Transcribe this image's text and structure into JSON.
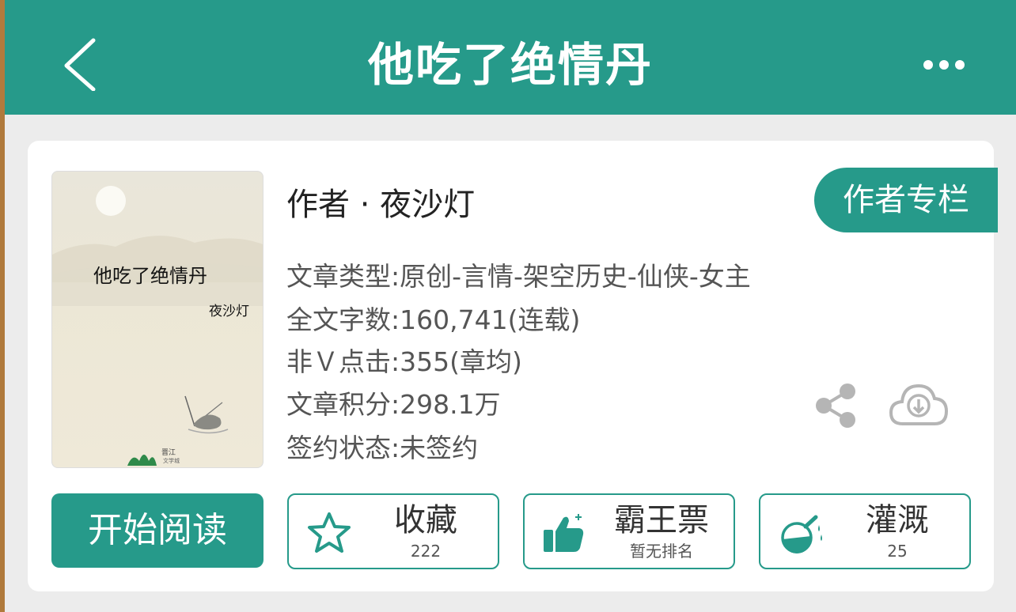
{
  "header": {
    "title": "他吃了绝情丹"
  },
  "cover": {
    "title": "他吃了绝情丹",
    "author": "夜沙灯"
  },
  "book": {
    "author_line": "作者 · 夜沙灯",
    "author_column_label": "作者专栏",
    "meta": [
      "文章类型:原创-言情-架空历史-仙侠-女主",
      "全文字数:160,741(连载)",
      "非Ｖ点击:355(章均)",
      "文章积分:298.1万",
      "签约状态:未签约"
    ]
  },
  "actions": {
    "read_label": "开始阅读",
    "favorite": {
      "label": "收藏",
      "count": "222"
    },
    "vote": {
      "label": "霸王票",
      "sub": "暂无排名"
    },
    "water": {
      "label": "灌溉",
      "count": "25"
    }
  },
  "icons": [
    "back-icon",
    "more-icon",
    "share-icon",
    "download-cloud-icon",
    "star-icon",
    "thumbs-up-icon",
    "flask-icon"
  ],
  "colors": {
    "accent": "#269a8a",
    "header_bg": "#269a8a",
    "page_bg": "#ececec",
    "text_gray": "#555555"
  }
}
